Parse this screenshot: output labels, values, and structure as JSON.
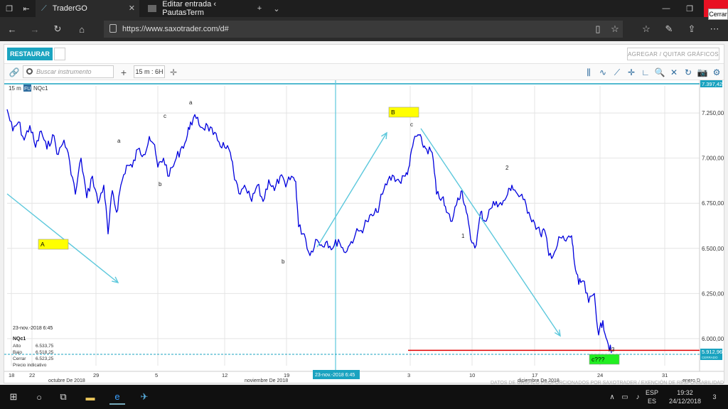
{
  "browser": {
    "tabs": [
      {
        "label": "TraderGO",
        "active": true
      },
      {
        "label": "Editar entrada ‹ PautasTerm",
        "active": false
      }
    ],
    "new_tab": "+",
    "url": "https://www.saxotrader.com/d#",
    "close_tooltip": "Cerrar"
  },
  "app": {
    "restore_label": "RESTAURAR",
    "add_remove_label": "AGREGAR / QUITAR GRÁFICOS",
    "search_placeholder": "Buscar instrumento",
    "interval_label": "15 m : 6H"
  },
  "chart_header": {
    "timeframe": "15 m",
    "badge": "FU",
    "symbol": "NQc1"
  },
  "chart_data": {
    "type": "line",
    "symbol": "NQc1",
    "ylim": [
      5850,
      7400
    ],
    "y_ticks": [
      "7.250,00",
      "7.000,00",
      "6.750,00",
      "6.500,00",
      "6.250,00",
      "6.000,00"
    ],
    "y_tick_values": [
      7250,
      7000,
      6750,
      6500,
      6250,
      6000
    ],
    "x_ticks": [
      "18",
      "22",
      "29",
      "5",
      "12",
      "19",
      "3",
      "10",
      "17",
      "24",
      "31"
    ],
    "month_labels": [
      "octubre De 2018",
      "noviembre De 2018",
      "diciembre De 2018",
      "enero D"
    ],
    "last_price_top": "7.397,42",
    "last_price_bottom": "5.912,96",
    "bottom_sublabel": "CERRADO",
    "crosshair_x_label": "23-nov.-2018 6:45",
    "series_points": [
      [
        0,
        7270
      ],
      [
        8,
        7150
      ],
      [
        16,
        7200
      ],
      [
        24,
        7100
      ],
      [
        32,
        7180
      ],
      [
        40,
        7060
      ],
      [
        48,
        7150
      ],
      [
        56,
        7050
      ],
      [
        64,
        7130
      ],
      [
        72,
        7020
      ],
      [
        80,
        7100
      ],
      [
        88,
        6980
      ],
      [
        96,
        6800
      ],
      [
        104,
        7000
      ],
      [
        112,
        6780
      ],
      [
        120,
        6900
      ],
      [
        128,
        6750
      ],
      [
        136,
        6850
      ],
      [
        142,
        6580
      ],
      [
        148,
        6820
      ],
      [
        154,
        6700
      ],
      [
        160,
        6850
      ],
      [
        168,
        6960
      ],
      [
        176,
        6950
      ],
      [
        184,
        7050
      ],
      [
        192,
        7020
      ],
      [
        200,
        7120
      ],
      [
        206,
        7080
      ],
      [
        212,
        6950
      ],
      [
        220,
        7000
      ],
      [
        228,
        6900
      ],
      [
        236,
        6980
      ],
      [
        244,
        7050
      ],
      [
        252,
        7100
      ],
      [
        258,
        7200
      ],
      [
        266,
        7220
      ],
      [
        274,
        7170
      ],
      [
        282,
        7180
      ],
      [
        290,
        7130
      ],
      [
        298,
        7090
      ],
      [
        306,
        7060
      ],
      [
        314,
        7030
      ],
      [
        320,
        6880
      ],
      [
        328,
        6800
      ],
      [
        336,
        6830
      ],
      [
        344,
        6760
      ],
      [
        352,
        6850
      ],
      [
        360,
        6760
      ],
      [
        368,
        6880
      ],
      [
        376,
        6820
      ],
      [
        384,
        6900
      ],
      [
        392,
        6840
      ],
      [
        400,
        6900
      ],
      [
        406,
        6870
      ],
      [
        410,
        6620
      ],
      [
        418,
        6580
      ],
      [
        426,
        6460
      ],
      [
        434,
        6550
      ],
      [
        442,
        6520
      ],
      [
        450,
        6540
      ],
      [
        458,
        6500
      ],
      [
        466,
        6550
      ],
      [
        474,
        6480
      ],
      [
        482,
        6520
      ],
      [
        490,
        6580
      ],
      [
        498,
        6600
      ],
      [
        506,
        6650
      ],
      [
        514,
        6680
      ],
      [
        520,
        6700
      ],
      [
        528,
        6800
      ],
      [
        536,
        6880
      ],
      [
        544,
        6900
      ],
      [
        552,
        6870
      ],
      [
        560,
        6900
      ],
      [
        566,
        6960
      ],
      [
        572,
        7100
      ],
      [
        578,
        7130
      ],
      [
        584,
        7080
      ],
      [
        590,
        7050
      ],
      [
        598,
        7030
      ],
      [
        604,
        6800
      ],
      [
        612,
        6780
      ],
      [
        618,
        6700
      ],
      [
        626,
        6650
      ],
      [
        634,
        6780
      ],
      [
        640,
        6820
      ],
      [
        646,
        6700
      ],
      [
        652,
        6550
      ],
      [
        660,
        6520
      ],
      [
        666,
        6700
      ],
      [
        672,
        6650
      ],
      [
        680,
        6720
      ],
      [
        688,
        6760
      ],
      [
        696,
        6740
      ],
      [
        704,
        6800
      ],
      [
        710,
        6850
      ],
      [
        718,
        6800
      ],
      [
        726,
        6770
      ],
      [
        734,
        6700
      ],
      [
        742,
        6640
      ],
      [
        750,
        6580
      ],
      [
        756,
        6600
      ],
      [
        762,
        6460
      ],
      [
        770,
        6480
      ],
      [
        778,
        6560
      ],
      [
        786,
        6540
      ],
      [
        794,
        6570
      ],
      [
        798,
        6420
      ],
      [
        804,
        6300
      ],
      [
        810,
        6320
      ],
      [
        818,
        6200
      ],
      [
        826,
        6250
      ],
      [
        832,
        6020
      ],
      [
        838,
        6100
      ],
      [
        844,
        5990
      ],
      [
        850,
        5920
      ]
    ],
    "annotations": [
      {
        "text": "A",
        "type": "box",
        "color": "#ffff00"
      },
      {
        "text": "B",
        "type": "box",
        "color": "#ffff00"
      },
      {
        "text": "c???",
        "type": "box",
        "color": "#22ee22"
      },
      {
        "text": "a"
      },
      {
        "text": "c"
      },
      {
        "text": "a"
      },
      {
        "text": "b"
      },
      {
        "text": "b"
      },
      {
        "text": "c"
      },
      {
        "text": "2"
      },
      {
        "text": "1"
      },
      {
        "text": "x3"
      }
    ],
    "info_box": {
      "datetime": "23-nov.-2018 6:45",
      "symbol": "NQc1",
      "rows": [
        {
          "label": "Alto",
          "value": "6.533,75"
        },
        {
          "label": "Bajo",
          "value": "6.518,25"
        },
        {
          "label": "Cerrar",
          "value": "6.523,25"
        }
      ],
      "footer": "Precio indicativo"
    },
    "colors": {
      "line": "#0000dd",
      "arrow": "#5cc8dc",
      "support": "#e00000",
      "dotted": "#1aa3c0"
    }
  },
  "taskbar": {
    "lang_top": "ESP",
    "lang_bottom": "ES",
    "time": "19:32",
    "date": "24/12/2018",
    "notifications": "3"
  }
}
